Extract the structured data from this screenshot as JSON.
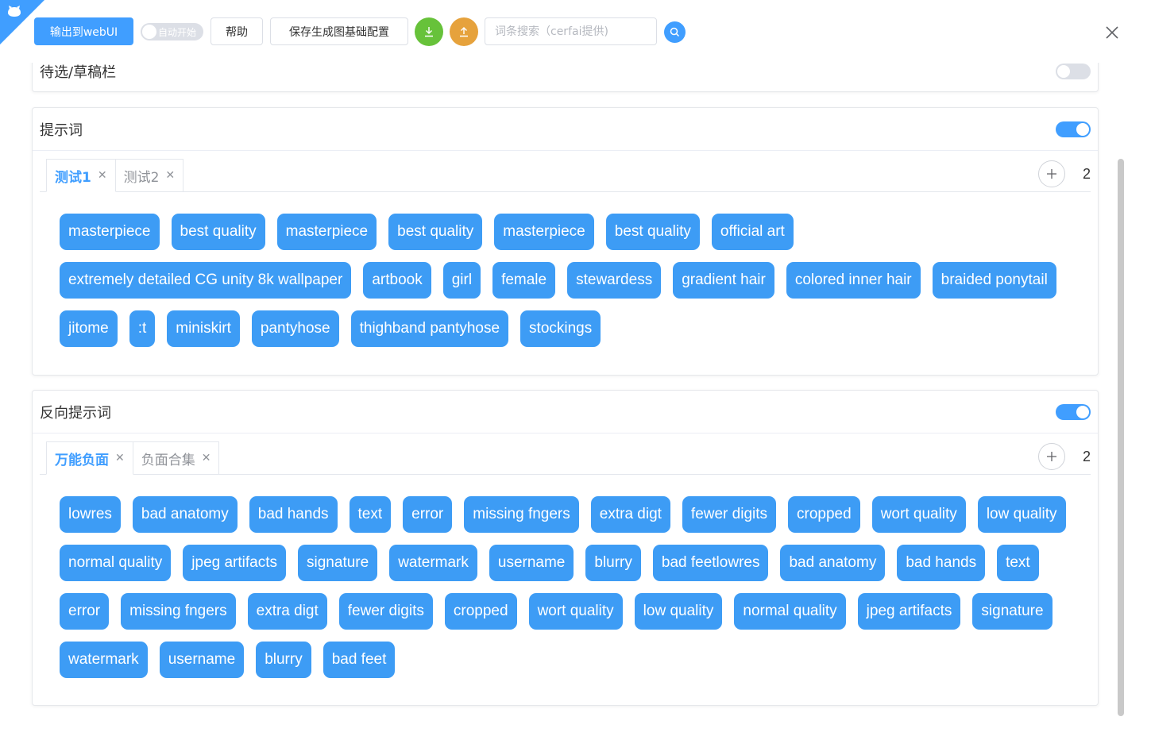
{
  "toolbar": {
    "export_label": "输出到webUI",
    "auto_start_label": "自动开始",
    "help_label": "帮助",
    "save_config_label": "保存生成图基础配置",
    "search_placeholder": "词条搜索（cerfai提供)"
  },
  "sections": {
    "draft": {
      "title": "待选/草稿栏",
      "enabled": false
    },
    "prompt": {
      "title": "提示词",
      "enabled": true,
      "tabs": [
        {
          "label": "测试1",
          "active": true
        },
        {
          "label": "测试2",
          "active": false
        }
      ],
      "tab_count": "2",
      "tags": [
        "masterpiece",
        "best quality",
        "masterpiece",
        "best quality",
        "masterpiece",
        "best quality",
        "official art",
        "extremely detailed CG unity 8k wallpaper",
        "artbook",
        "girl",
        "female",
        "stewardess",
        "gradient hair",
        "colored inner hair",
        "braided ponytail",
        "jitome",
        ":t",
        "miniskirt",
        "pantyhose",
        "thighband pantyhose",
        "stockings"
      ]
    },
    "negative": {
      "title": "反向提示词",
      "enabled": true,
      "tabs": [
        {
          "label": "万能负面",
          "active": true
        },
        {
          "label": "负面合集",
          "active": false
        }
      ],
      "tab_count": "2",
      "tags": [
        "lowres",
        "bad anatomy",
        "bad hands",
        "text",
        "error",
        "missing fngers",
        "extra digt",
        "fewer digits",
        "cropped",
        "wort quality",
        "low quality",
        "normal quality",
        "jpeg artifacts",
        "signature",
        "watermark",
        "username",
        "blurry",
        "bad feetlowres",
        "bad anatomy",
        "bad hands",
        "text",
        "error",
        "missing fngers",
        "extra digt",
        "fewer digits",
        "cropped",
        "wort quality",
        "low quality",
        "normal quality",
        "jpeg artifacts",
        "signature",
        "watermark",
        "username",
        "blurry",
        "bad feet"
      ]
    }
  },
  "colors": {
    "accent": "#409eff",
    "success": "#67c23a",
    "warning": "#e6a23c",
    "tag": "#3d9cf5"
  },
  "icons": {
    "corner": "github-cat-icon",
    "download": "download-icon",
    "upload": "upload-icon",
    "search": "search-icon",
    "close": "close-icon",
    "add": "plus-icon"
  }
}
